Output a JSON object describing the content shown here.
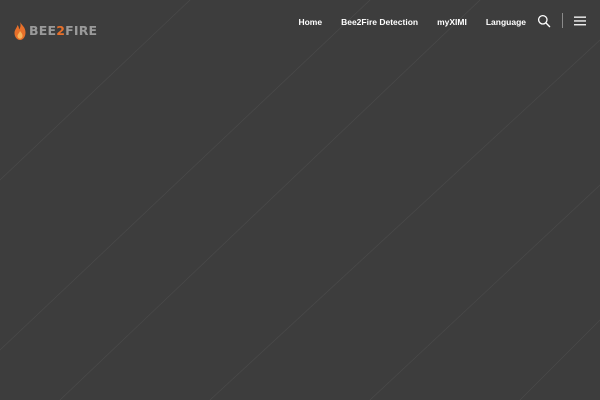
{
  "logo": {
    "prefix": "BEE",
    "accent": "2",
    "suffix": "FIRE"
  },
  "nav": {
    "items": [
      {
        "label": "Home"
      },
      {
        "label": "Bee2Fire Detection"
      },
      {
        "label": "myXIMI"
      },
      {
        "label": "Language"
      }
    ]
  },
  "icons": {
    "search": "search-icon",
    "menu": "hamburger-menu-icon",
    "logo": "flame-icon"
  },
  "colors": {
    "background": "#3d3d3d",
    "accent": "#e8702a",
    "nav_text": "#ffffff",
    "logo_gray": "#9a9a9a"
  }
}
